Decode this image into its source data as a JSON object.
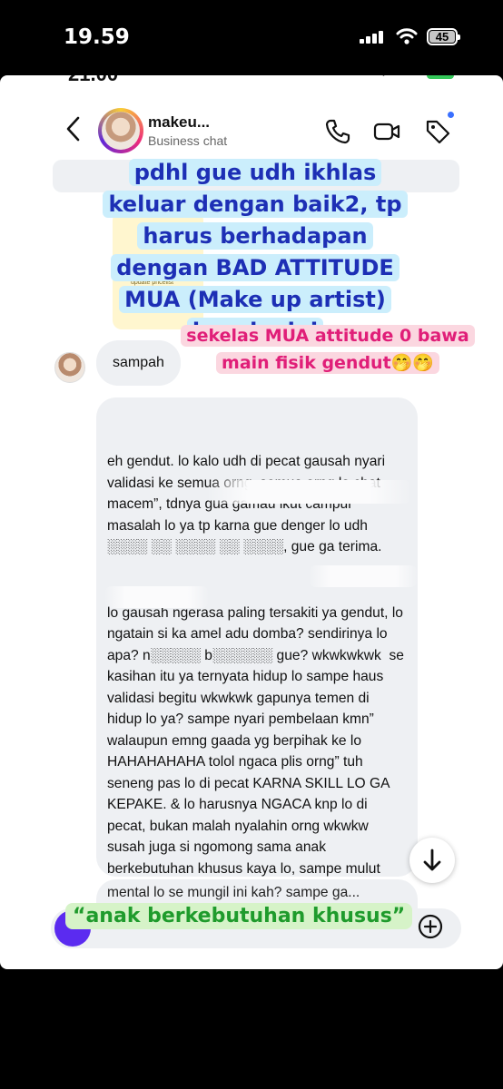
{
  "outer_status": {
    "time": "19.59",
    "battery": "45"
  },
  "inner_status": {
    "time": "21.00",
    "battery": "75"
  },
  "header": {
    "username": "makeu...",
    "subtitle": "Business chat"
  },
  "thumb_caption": "update pricelist",
  "captions": {
    "top": "pdhl gue udh ikhlas keluar dengan baik2, tp harus berhadapan dengan BAD ATTITUDE MUA (Make up artist) kayak gini",
    "middle": "sekelas MUA attitude 0 bawa main fisik gendut🤭🤭",
    "bottom": "“anak berkebutuhan khusus”"
  },
  "messages": {
    "first": "sampah",
    "long_p1": "eh gendut. lo kalo udh di pecat gausah nyari validasi ke semua orng, semua orng lo chat macem”, tdnya gua gamau ikut campur masalah lo ya tp karna gue denger lo udh ░░░░ ░░ ░░░░ ░░ ░░░░, gue ga terima.",
    "long_p2": "lo gausah ngerasa paling tersakiti ya gendut, lo ngatain si ka amel adu domba? sendirinya lo apa? n░░░░░ b░░░░░░ gue? wkwkwkwk  se kasihan itu ya ternyata hidup lo sampe haus validasi begitu wkwkwk gapunya temen di hidup lo ya? sampe nyari pembelaan kmn” walaupun emng gaada yg berpihak ke lo HAHAHAHAHA tolol ngaca plis orng” tuh seneng pas lo di pecat KARNA SKILL LO GA KEPAKE. & lo harusnya NGACA knp lo di pecat, bukan malah nyalahin orng wkwkw susah juga si ngomong sama anak berkebutuhan khusus kaya lo, sampe mulut gue pindah ke pantat jg gaakan masuk ke otak mungil lo itu wkwkw",
    "next_partial": "mental lo se mungil ini kah? sampe ga..."
  }
}
